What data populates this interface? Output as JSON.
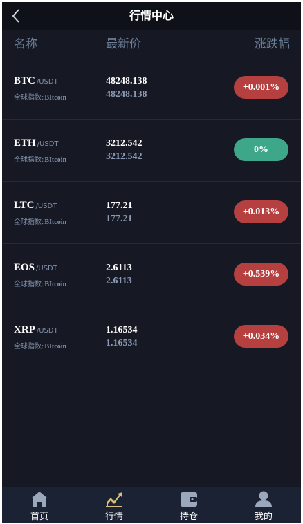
{
  "header": {
    "title": "行情中心"
  },
  "columns": {
    "name": "名称",
    "price": "最新价",
    "change": "涨跌幅"
  },
  "colors": {
    "up": "#b5403f",
    "flat": "#3fa789",
    "active_icon": "#d9c07a",
    "icon": "#9aa7bd"
  },
  "rows": [
    {
      "symbol": "BTC",
      "quote": "/USDT",
      "index_label": "全球指数:",
      "index_value": "BItcoin",
      "price": "48248.138",
      "price2": "48248.138",
      "change": "+0.001%",
      "trend": "up"
    },
    {
      "symbol": "ETH",
      "quote": "/USDT",
      "index_label": "全球指数:",
      "index_value": "BItcoin",
      "price": "3212.542",
      "price2": "3212.542",
      "change": "0%",
      "trend": "flat"
    },
    {
      "symbol": "LTC",
      "quote": "/USDT",
      "index_label": "全球指数:",
      "index_value": "BItcoin",
      "price": "177.21",
      "price2": "177.21",
      "change": "+0.013%",
      "trend": "up"
    },
    {
      "symbol": "EOS",
      "quote": "/USDT",
      "index_label": "全球指数:",
      "index_value": "BItcoin",
      "price": "2.6113",
      "price2": "2.6113",
      "change": "+0.539%",
      "trend": "up"
    },
    {
      "symbol": "XRP",
      "quote": "/USDT",
      "index_label": "全球指数:",
      "index_value": "BItcoin",
      "price": "1.16534",
      "price2": "1.16534",
      "change": "+0.034%",
      "trend": "up"
    }
  ],
  "tabs": [
    {
      "label": "首页",
      "icon": "home-icon",
      "active": false
    },
    {
      "label": "行情",
      "icon": "chart-icon",
      "active": true
    },
    {
      "label": "持仓",
      "icon": "wallet-icon",
      "active": false
    },
    {
      "label": "我的",
      "icon": "user-icon",
      "active": false
    }
  ]
}
